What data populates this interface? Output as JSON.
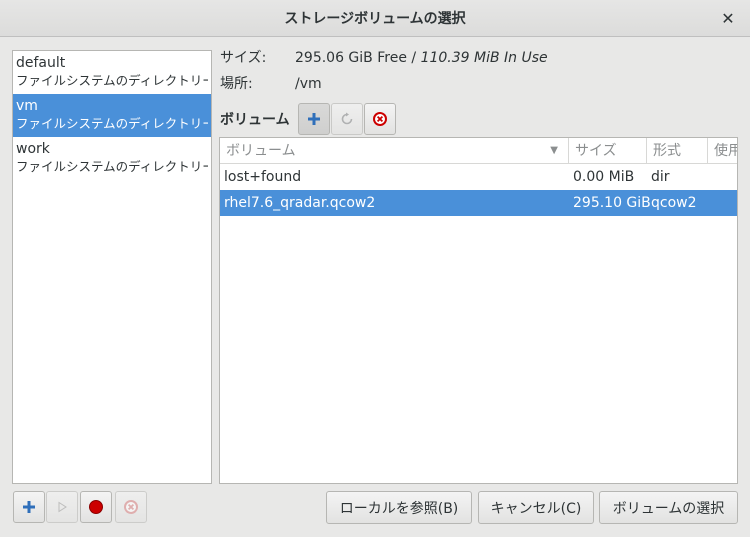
{
  "window": {
    "title": "ストレージボリュームの選択",
    "close_glyph": "✕"
  },
  "pools": [
    {
      "name": "default",
      "desc": "ファイルシステムのディレクトリー",
      "selected": false
    },
    {
      "name": "vm",
      "desc": "ファイルシステムのディレクトリー",
      "selected": true
    },
    {
      "name": "work",
      "desc": "ファイルシステムのディレクトリー",
      "selected": false
    }
  ],
  "details": {
    "size_label": "サイズ:",
    "size_free": "295.06 GiB Free /",
    "size_inuse": "110.39 MiB In Use",
    "location_label": "場所:",
    "location_value": "/vm"
  },
  "volumes": {
    "label": "ボリューム",
    "columns": [
      "ボリューム",
      "サイズ",
      "形式",
      "使用"
    ],
    "rows": [
      {
        "name": "lost+found",
        "size": "0.00 MiB",
        "format": "dir",
        "used": "",
        "selected": false
      },
      {
        "name": "rhel7.6_qradar.qcow2",
        "size": "295.10 GiB",
        "format": "qcow2",
        "used": "",
        "selected": true
      }
    ]
  },
  "buttons": {
    "browse_local": "ローカルを参照(B)",
    "cancel": "キャンセル(C)",
    "choose_volume": "ボリュームの選択"
  },
  "colors": {
    "selection": "#4a90d9",
    "add_icon": "#2f6fba",
    "stop_icon": "#cc0000",
    "delete_icon": "#cc0000"
  }
}
